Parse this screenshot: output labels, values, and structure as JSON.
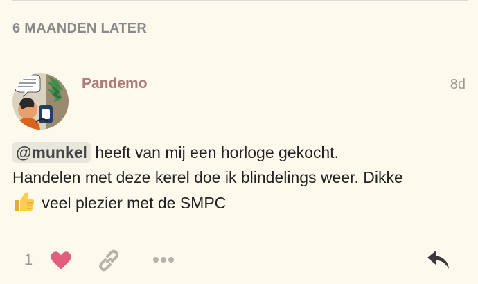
{
  "time_gap_label": "6 MAANDEN LATER",
  "post": {
    "username": "Pandemo",
    "date": "8d",
    "mention": "@munkel",
    "text_line1": " heeft van mij een horloge gekocht.",
    "text_line2": "Handelen met deze kerel doe ik blindelings weer. Dikke",
    "text_line3": " veel plezier met de SMPC",
    "emoji": "thumbs-up"
  },
  "actions": {
    "like_count": "1",
    "like_icon": "heart-icon",
    "link_icon": "link-icon",
    "more_icon": "more-icon",
    "reply_icon": "reply-icon"
  },
  "colors": {
    "background": "#fdfaed",
    "username": "#b07a75",
    "heart": "#e05f7c",
    "muted": "#9a9a92"
  }
}
